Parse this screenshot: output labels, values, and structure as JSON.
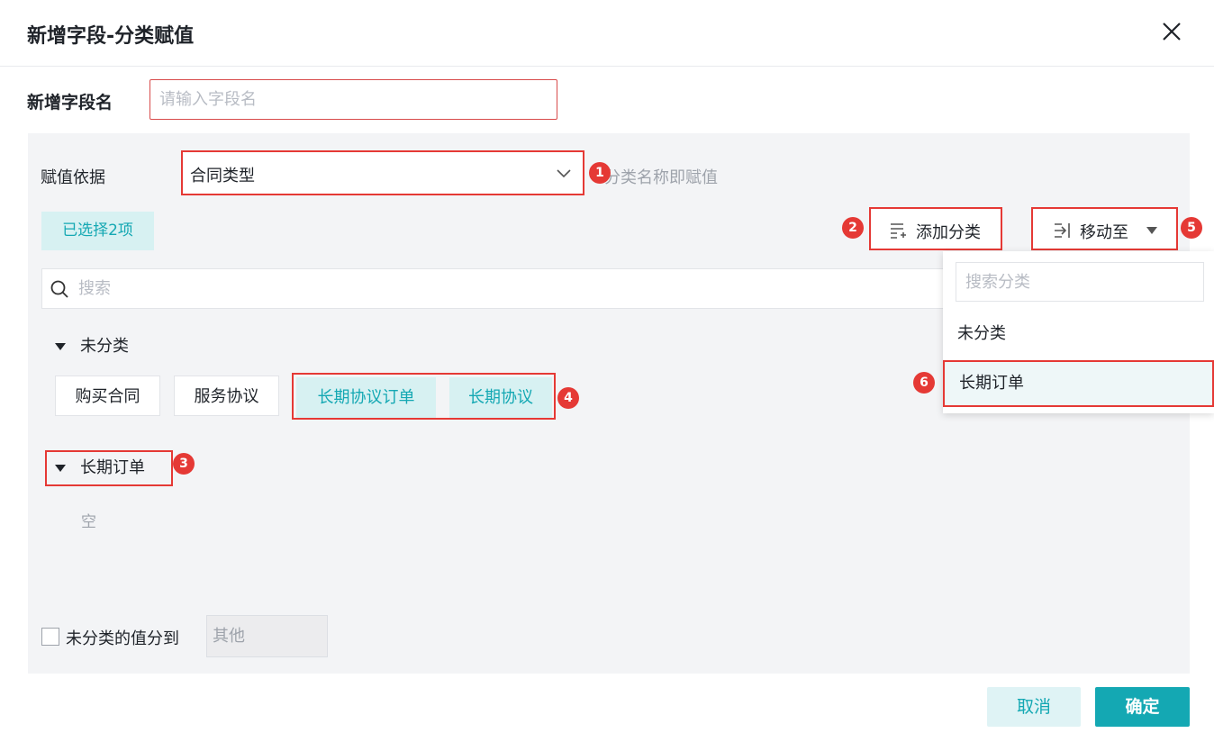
{
  "dialog": {
    "title": "新增字段-分类赋值",
    "close_icon": "close-icon"
  },
  "field_name": {
    "label": "新增字段名",
    "placeholder": "请输入字段名",
    "value": ""
  },
  "basis": {
    "label": "赋值依据",
    "selected": "合同类型",
    "hint": "分类名称即赋值"
  },
  "toolbar": {
    "selected_count": "已选择2项",
    "add_category": "添加分类",
    "move_to": "移动至"
  },
  "search": {
    "placeholder": "搜索"
  },
  "groups": [
    {
      "name": "未分类",
      "items": [
        {
          "label": "购买合同",
          "selected": false
        },
        {
          "label": "服务协议",
          "selected": false
        },
        {
          "label": "长期协议订单",
          "selected": true
        },
        {
          "label": "长期协议",
          "selected": true
        }
      ]
    },
    {
      "name": "长期订单",
      "empty_text": "空"
    }
  ],
  "unclassified": {
    "label": "未分类的值分到",
    "value": "其他",
    "checked": false
  },
  "move_dropdown": {
    "search_placeholder": "搜索分类",
    "options": [
      "未分类",
      "长期订单"
    ]
  },
  "footer": {
    "cancel": "取消",
    "confirm": "确定"
  },
  "annotations": [
    "1",
    "2",
    "3",
    "4",
    "5",
    "6"
  ],
  "colors": {
    "accent": "#14a8b3",
    "annotation": "#e53935",
    "selected_bg": "#d7f1f2"
  }
}
